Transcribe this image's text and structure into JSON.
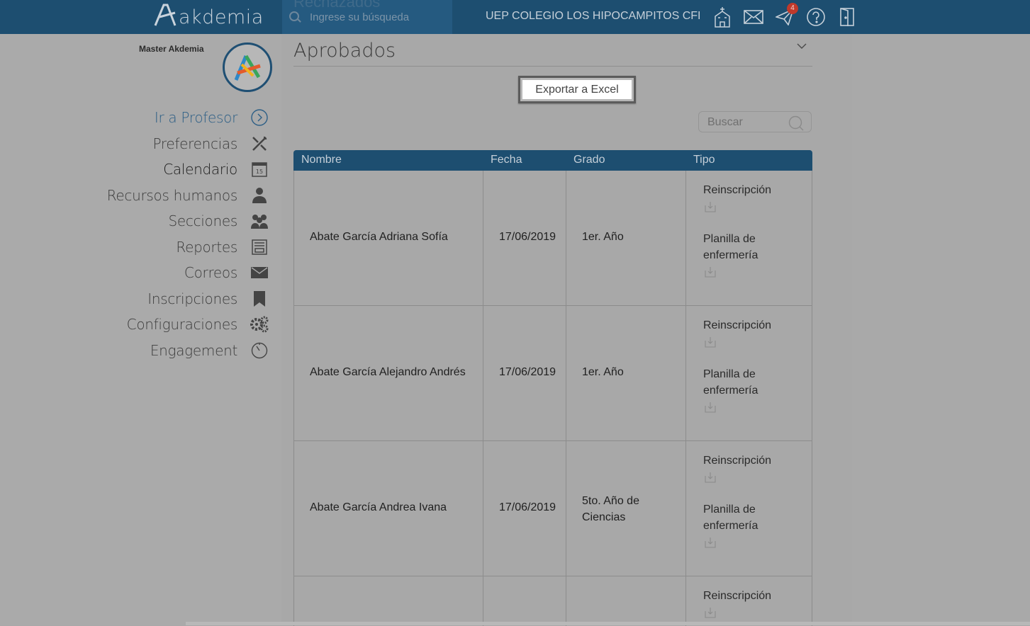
{
  "header": {
    "logo_text": "akdemia",
    "ghost_tab": "Rechazados",
    "search_placeholder": "Ingrese su búsqueda",
    "school_name": "UEP COLEGIO LOS HIPOCAMPITOS CFI",
    "icons": [
      "school-icon",
      "mail-icon",
      "send-icon",
      "help-icon",
      "logout-icon"
    ],
    "notification_count": "4"
  },
  "sidebar": {
    "user_name": "Master Akdemia",
    "items": [
      {
        "label": "Ir a Profesor",
        "icon": "chevron-right-circle-icon"
      },
      {
        "label": "Preferencias",
        "icon": "tools-icon"
      },
      {
        "label": "Calendario",
        "icon": "calendar-icon"
      },
      {
        "label": "Recursos humanos",
        "icon": "person-icon"
      },
      {
        "label": "Secciones",
        "icon": "group-icon"
      },
      {
        "label": "Reportes",
        "icon": "report-icon"
      },
      {
        "label": "Correos",
        "icon": "mail-icon"
      },
      {
        "label": "Inscripciones",
        "icon": "bookmark-icon"
      },
      {
        "label": "Configuraciones",
        "icon": "gears-icon"
      },
      {
        "label": "Engagement",
        "icon": "timer-icon"
      }
    ],
    "calendar_day": "15"
  },
  "main": {
    "title": "Aprobados",
    "export_label": "Exportar a Excel",
    "search_placeholder": "Buscar",
    "columns": [
      "Nombre",
      "Fecha",
      "Grado",
      "Tipo"
    ],
    "rows": [
      {
        "nombre": "Abate García Adriana Sofía",
        "fecha": "17/06/2019",
        "grado": "1er. Año",
        "tipo": [
          "Reinscripción",
          "Planilla de enfermería"
        ]
      },
      {
        "nombre": "Abate García Alejandro Andrés",
        "fecha": "17/06/2019",
        "grado": "1er. Año",
        "tipo": [
          "Reinscripción",
          "Planilla de enfermería"
        ]
      },
      {
        "nombre": "Abate García Andrea Ivana",
        "fecha": "17/06/2019",
        "grado": "5to. Año de Ciencias",
        "tipo": [
          "Reinscripción",
          "Planilla de enfermería"
        ]
      },
      {
        "nombre": "",
        "fecha": "",
        "grado": "",
        "tipo": [
          "Reinscripción"
        ]
      }
    ]
  },
  "colors": {
    "header_bg": "#1d4e70",
    "accent": "#2d5f86",
    "badge": "#c0392b"
  }
}
